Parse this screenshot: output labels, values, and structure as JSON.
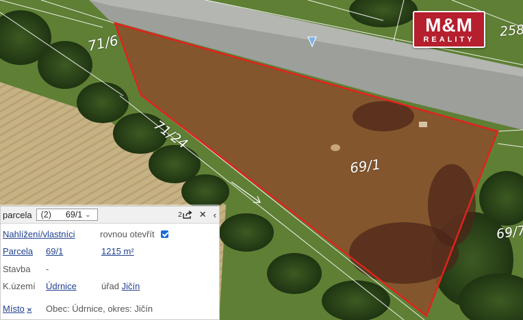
{
  "logo": {
    "text": "M&M",
    "sub": "REALITY",
    "color": "#b51f2e"
  },
  "map_labels": [
    {
      "text": "71/6"
    },
    {
      "text": "71/24"
    },
    {
      "text": "69/1"
    },
    {
      "text": "69/7"
    },
    {
      "text": "258"
    }
  ],
  "parcel_outline_color": "#e3211e",
  "panel": {
    "title": "parcela",
    "select": {
      "count": "(2)",
      "value": "69/1",
      "options_icon": "chevron-down-icon"
    },
    "header_icons": {
      "share_count": "2",
      "share_icon": "share-icon",
      "close_icon": "close-icon",
      "collapse_icon": "chevron-left-icon"
    },
    "rows": {
      "view": {
        "link": "Nahlížení/vlastníci",
        "text": "rovnou otevřít",
        "checked": true
      },
      "parcel": {
        "label": "Parcela",
        "number": "69/1",
        "area": "1215 m²"
      },
      "building": {
        "label": "Stavba",
        "value": "-"
      },
      "territory": {
        "label": "K.území",
        "value": "Údrnice",
        "office_label": "úřad",
        "office": "Jičín"
      },
      "place": {
        "label": "Místo",
        "icon": "share-arrow-icon",
        "value": "Obec: Údrnice, okres: Jičín"
      }
    }
  }
}
